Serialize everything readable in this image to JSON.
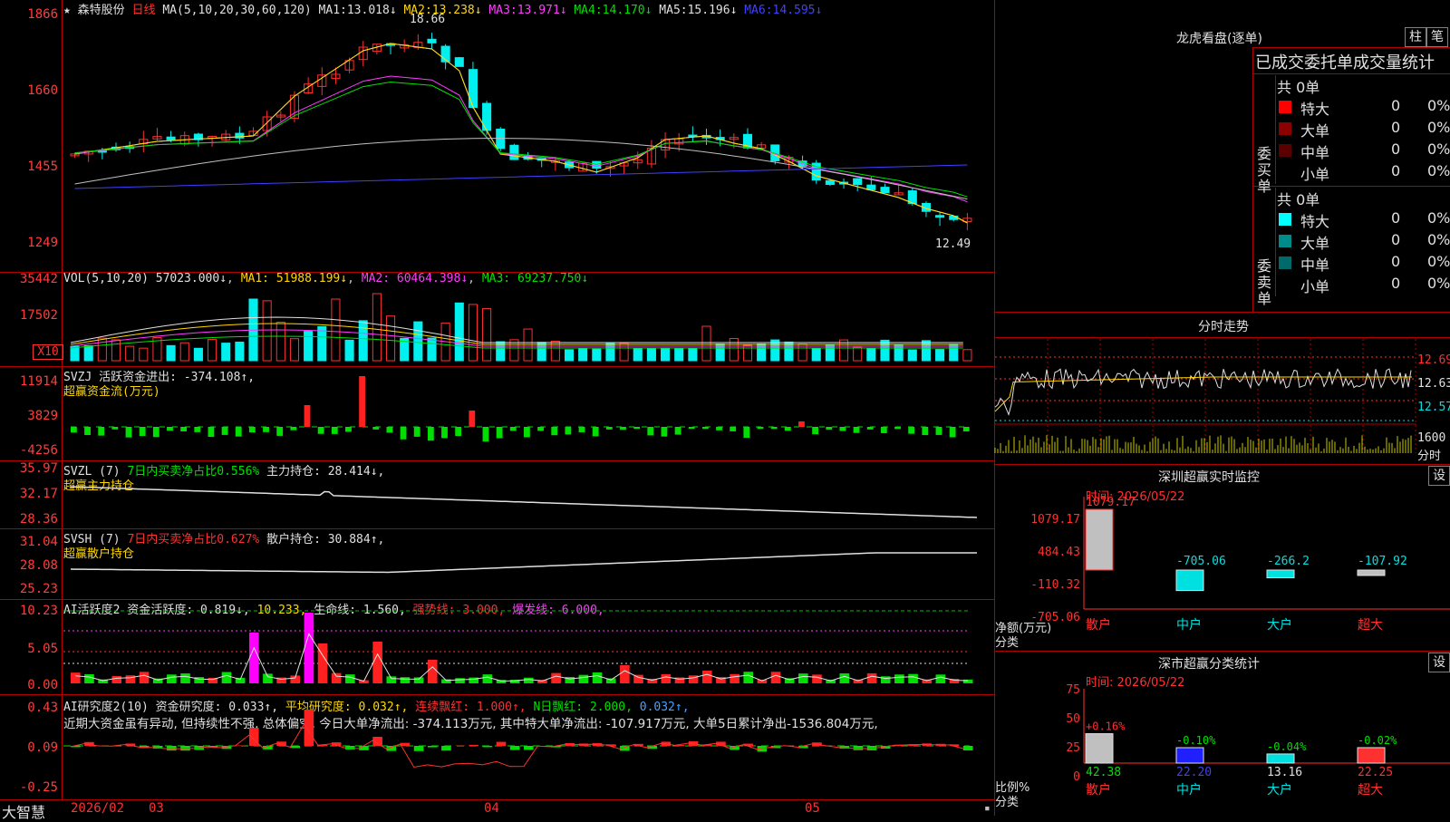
{
  "stock": {
    "name": "森特股份",
    "period": "日线"
  },
  "price_pane": {
    "ma_label": "MA(5,10,20,30,60,120)",
    "ma": [
      {
        "label": "MA1:",
        "value": "13.018↓",
        "color": "#e0e0e0"
      },
      {
        "label": "MA2:",
        "value": "13.238↓",
        "color": "#ffd800"
      },
      {
        "label": "MA3:",
        "value": "13.971↓",
        "color": "#ff3cff"
      },
      {
        "label": "MA4:",
        "value": "14.170↓",
        "color": "#00e000"
      },
      {
        "label": "MA5:",
        "value": "15.196↓",
        "color": "#c0c0c0"
      },
      {
        "label": "MA6:",
        "value": "14.595↓",
        "color": "#4040ff"
      }
    ],
    "y_ticks": [
      "1866",
      "1660",
      "1455",
      "1249"
    ],
    "high_mark": "18.66",
    "low_mark": "12.49"
  },
  "vol_pane": {
    "label": "VOL(5,10,20)",
    "value": "57023.000↓",
    "ma1": "MA1: 51988.199↓",
    "ma2": "MA2: 60464.398↓",
    "ma3": "MA3: 69237.750↓",
    "y_ticks": [
      "35442",
      "17502"
    ],
    "unit": "X10"
  },
  "svzj_pane": {
    "label": "SVZJ",
    "text": "活跃资金进出: -374.108↑,",
    "sub": "超赢资金流(万元)",
    "y_ticks": [
      "11914",
      "3829",
      "-4256"
    ]
  },
  "svzl_pane": {
    "label": "SVZL (7)",
    "text1": "7日内买卖净占比0.556%",
    "text2": "主力持仓: 28.414↓,",
    "sub": "超赢主力持仓",
    "y_ticks": [
      "35.97",
      "32.17",
      "28.36"
    ]
  },
  "svsh_pane": {
    "label": "SVSH (7)",
    "text1": "7日内买卖净占比0.627%",
    "text2": "散户持仓: 30.884↑,",
    "sub": "超赢散户持仓",
    "y_ticks": [
      "31.04",
      "28.08",
      "25.23"
    ]
  },
  "ai_active": {
    "label": "AI活跃度2",
    "t1": "资金活跃度: 0.819↓,",
    "t2": "10.233,",
    "t3": "生命线: 1.560,",
    "t4": "强势线: 3.000,",
    "t5": "爆发线: 6.000,",
    "y_ticks": [
      "10.23",
      "5.05",
      "0.00"
    ]
  },
  "ai_research": {
    "label": "AI研究度2(10)",
    "t1": "资金研究度: 0.033↑,",
    "t2": "平均研究度: 0.032↑,",
    "t3": "连续飘红: 1.000↑,",
    "t4": "N日飘红: 2.000,",
    "t5": "0.032↑,",
    "comment": "近期大资金虽有异动, 但持续性不强, 总体偏空, 今日大单净流出: -374.113万元, 其中特大单净流出: -107.917万元, 大单5日累计净出-1536.804万元,",
    "y_ticks": [
      "0.43",
      "0.09",
      "-0.25"
    ]
  },
  "x_axis": {
    "labels": [
      "2026/02",
      "03",
      "04",
      "05"
    ],
    "brand": "大智慧"
  },
  "right": {
    "dragon_title": "龙虎看盘(逐单)",
    "btn1": "柱",
    "btn2": "笔",
    "stats_title": "已成交委托单成交量统计",
    "buy": {
      "side": "委买单",
      "total": "共 0单",
      "rows": [
        {
          "name": "特大",
          "v": "0",
          "p": "0%",
          "color": "#ff0000"
        },
        {
          "name": "大单",
          "v": "0",
          "p": "0%",
          "color": "#8b0000"
        },
        {
          "name": "中单",
          "v": "0",
          "p": "0%",
          "color": "#5a0000"
        },
        {
          "name": "小单",
          "v": "0",
          "p": "0%",
          "color": "#000000"
        }
      ]
    },
    "sell": {
      "side": "委卖单",
      "total": "共 0单",
      "rows": [
        {
          "name": "特大",
          "v": "0",
          "p": "0%",
          "color": "#00ffff"
        },
        {
          "name": "大单",
          "v": "0",
          "p": "0%",
          "color": "#008b8b"
        },
        {
          "name": "中单",
          "v": "0",
          "p": "0%",
          "color": "#006a6a"
        },
        {
          "name": "小单",
          "v": "0",
          "p": "0%",
          "color": "#000000"
        }
      ]
    },
    "intraday": {
      "title": "分时走势",
      "p1": "12.69",
      "p2": "12.63",
      "p3": "12.57",
      "vol": "1600",
      "unit": "分时"
    },
    "monitor": {
      "title": "深圳超赢实时监控",
      "btn": "设",
      "date": "时间: 2026/05/22",
      "y_ticks": [
        "1079.17",
        "484.43",
        "-110.32",
        "-705.06"
      ],
      "ylabel": "净额(万元)",
      "xlabel": "分类",
      "cats": [
        {
          "name": "散户",
          "value": "1079.17"
        },
        {
          "name": "中户",
          "value": "-705.06"
        },
        {
          "name": "大户",
          "value": "-266.2"
        },
        {
          "name": "超大",
          "value": "-107.92"
        }
      ]
    },
    "classify": {
      "title": "深市超赢分类统计",
      "btn": "设",
      "date": "时间: 2026/05/22",
      "y_ticks": [
        "75",
        "50",
        "25",
        "0"
      ],
      "ylabel": "比例%",
      "xlabel": "分类",
      "cats": [
        {
          "name": "散户",
          "pct": "+0.16%",
          "value": "42.38"
        },
        {
          "name": "中户",
          "pct": "-0.10%",
          "value": "22.20"
        },
        {
          "name": "大户",
          "pct": "-0.04%",
          "value": "13.16"
        },
        {
          "name": "超大",
          "pct": "-0.02%",
          "value": "22.25"
        }
      ]
    }
  }
}
